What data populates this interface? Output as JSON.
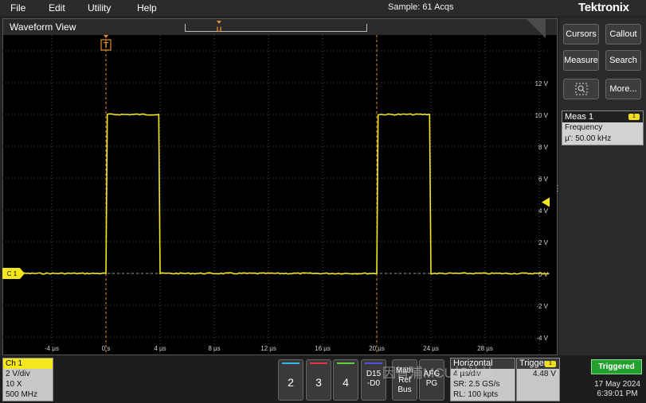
{
  "menu": {
    "file": "File",
    "edit": "Edit",
    "utility": "Utility",
    "help": "Help"
  },
  "acq_status": "Sample: 61 Acqs",
  "brand": "Tektronix",
  "waveform_view": {
    "title": "Waveform View",
    "trigger_marker": "T",
    "record_marker": "U",
    "y_ticks": [
      "12 V",
      "10 V",
      "8 V",
      "6 V",
      "4 V",
      "2 V",
      "0 V",
      "-2 V",
      "-4 V"
    ],
    "x_ticks": [
      "-4 µs",
      "0 s",
      "4 µs",
      "8 µs",
      "12 µs",
      "16 µs",
      "20 µs",
      "24 µs",
      "28 µs"
    ],
    "channel_label": "C 1",
    "trace_color": "#f4e71d",
    "cursor_color": "#e0902a"
  },
  "side_panel": {
    "cursors": "Cursors",
    "callout": "Callout",
    "measure": "Measure",
    "search": "Search",
    "more": "More..."
  },
  "measurement": {
    "title": "Meas 1",
    "badge": "1",
    "name": "Frequency",
    "value": "µ': 50.00 kHz"
  },
  "channel": {
    "name": "Ch 1",
    "scale": "2 V/div",
    "probe": "10 X",
    "bandwidth": "500 MHz"
  },
  "channel_buttons": [
    {
      "label": "2",
      "color": "#30b8e8"
    },
    {
      "label": "3",
      "color": "#e83048"
    },
    {
      "label": "4",
      "color": "#60d040"
    }
  ],
  "digital_button": {
    "line1": "D15",
    "line2": "-D0",
    "color": "#5050e0"
  },
  "math_button": {
    "line1": "Math",
    "line2": "Ref",
    "line3": "Bus"
  },
  "afg_button": {
    "line1": "AFG",
    "line2": "PG"
  },
  "horizontal": {
    "title": "Horizontal",
    "scale": "4 µs/div",
    "sample_rate": "SR: 2.5 GS/s",
    "record_length": "RL: 100 kpts"
  },
  "trigger": {
    "title": "Trigger",
    "badge": "1",
    "level": "4.48 V"
  },
  "status": "Triggered",
  "date": "17 May 2024",
  "time": "6:39:01 PM",
  "watermark": "因智浦MCU加油站"
}
